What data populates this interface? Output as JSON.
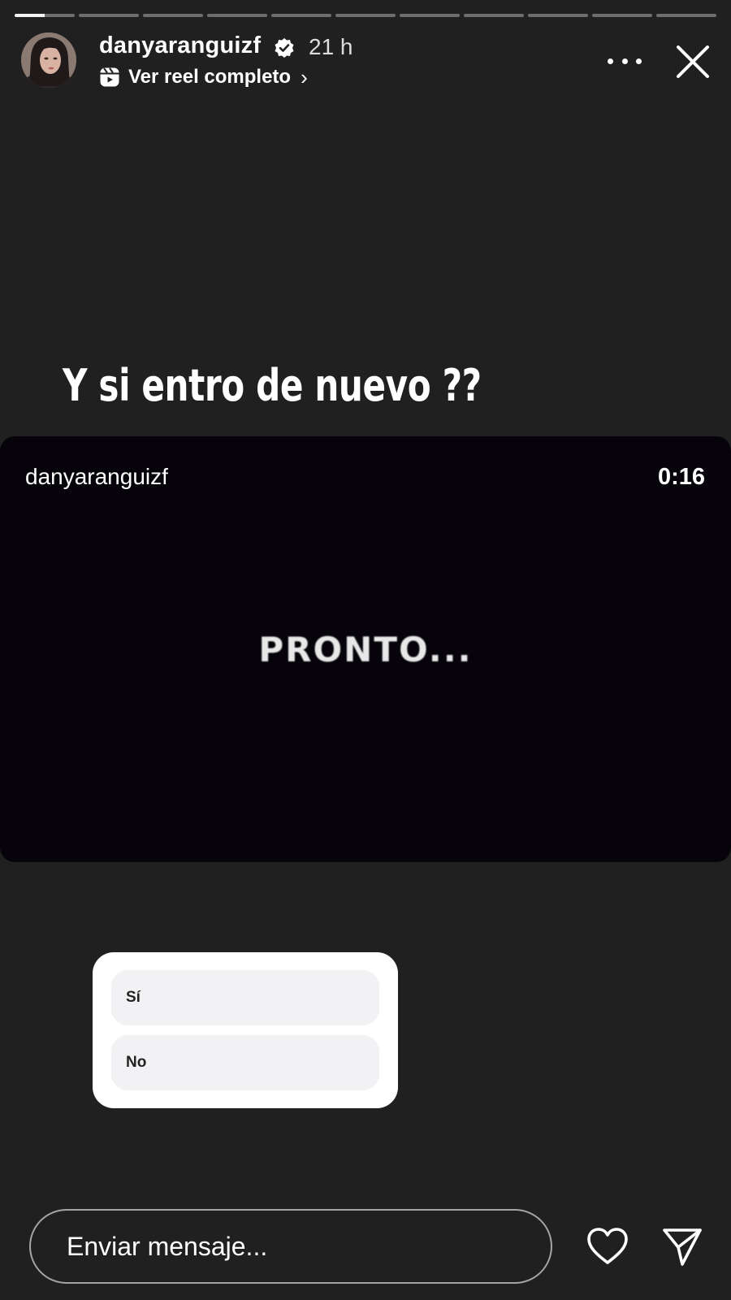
{
  "progress": {
    "segments": 11,
    "active_index": 0,
    "active_fill": 0.5
  },
  "header": {
    "username": "danyaranguizf",
    "verified": true,
    "time": "21 h",
    "reel_link_label": "Ver reel completo",
    "reel_link_chevron": "›"
  },
  "caption": "Y si entro de nuevo ??",
  "reel": {
    "username": "danyaranguizf",
    "duration": "0:16",
    "overlay_text": "PRONTO..."
  },
  "poll": {
    "options": [
      "Sí",
      "No"
    ]
  },
  "footer": {
    "message_placeholder": "Enviar mensaje..."
  },
  "colors": {
    "background": "#202020",
    "reel_background": "#06040a",
    "poll_background": "#ffffff",
    "poll_option": "#f2f2f4"
  },
  "icons": [
    "verified-badge-icon",
    "reels-icon",
    "more-icon",
    "close-icon",
    "heart-icon",
    "send-icon"
  ]
}
